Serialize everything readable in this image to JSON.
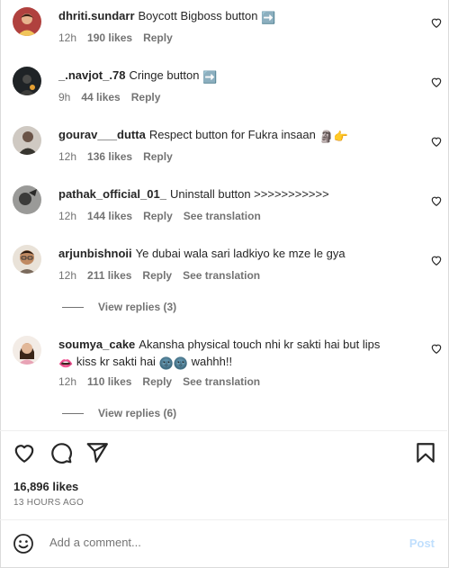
{
  "comments": [
    {
      "username": "dhriti.sundarr",
      "text": "Boycott Bigboss button",
      "emoji": "➡️",
      "time": "12h",
      "likes": "190 likes",
      "reply": "Reply",
      "see_translation": "",
      "avatar_color": "#b0413e"
    },
    {
      "username": "_.navjot_.78",
      "text": "Cringe button",
      "emoji": "➡️",
      "time": "9h",
      "likes": "44 likes",
      "reply": "Reply",
      "see_translation": "",
      "avatar_color": "#2b2b2b"
    },
    {
      "username": "gourav___dutta",
      "text": "Respect button for Fukra insaan",
      "emoji": "🗿👉",
      "time": "12h",
      "likes": "136 likes",
      "reply": "Reply",
      "see_translation": "",
      "avatar_color": "#8a8076"
    },
    {
      "username": "pathak_official_01_",
      "text": "Uninstall button >>>>>>>>>>>",
      "emoji": "",
      "time": "12h",
      "likes": "144 likes",
      "reply": "Reply",
      "see_translation": "See translation",
      "avatar_color": "#6d6d6d"
    },
    {
      "username": "arjunbishnoii",
      "text": "Ye dubai wala sari ladkiyo ke mze le gya",
      "emoji": "",
      "time": "12h",
      "likes": "211 likes",
      "reply": "Reply",
      "see_translation": "See translation",
      "avatar_color": "#c9a27a"
    },
    {
      "username": "soumya_cake",
      "text": "Akansha physical touch nhi kr sakti hai but lips",
      "text2": "kiss kr sakti hai",
      "text3": "wahhh!!",
      "emoji": "👄",
      "emoji2": "🌚🌚",
      "time": "12h",
      "likes": "110 likes",
      "reply": "Reply",
      "see_translation": "See translation",
      "avatar_color": "#e4b8a7"
    }
  ],
  "view_replies": [
    "View replies (3)",
    "View replies (6)"
  ],
  "post": {
    "likes": "16,896 likes",
    "time_ago": "13 HOURS AGO"
  },
  "add_comment": {
    "placeholder": "Add a comment...",
    "post_label": "Post"
  },
  "icons": [
    "heart-icon",
    "comment-icon",
    "share-icon",
    "bookmark-icon",
    "emoji-icon"
  ],
  "colors": {
    "text": "#262626",
    "muted": "#737373",
    "post_disabled": "#c0dffd",
    "lips": "#d6283a"
  }
}
